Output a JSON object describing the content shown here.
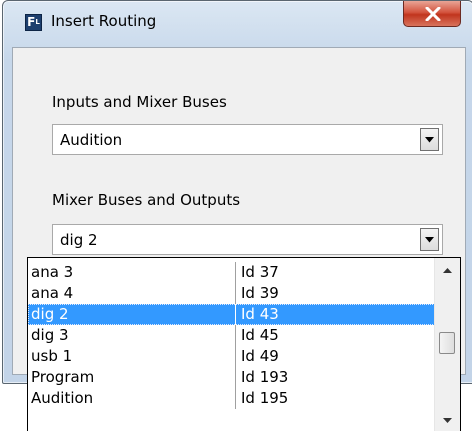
{
  "window": {
    "title": "Insert Routing",
    "icon_letter": "F",
    "icon_sub": "L",
    "icons": {
      "app": "app-logo-icon",
      "close": "close-icon"
    }
  },
  "inputs": {
    "label": "Inputs and Mixer Buses",
    "selected": "Audition"
  },
  "outputs": {
    "label": "Mixer Buses and Outputs",
    "selected": "dig 2"
  },
  "dropdown_list": {
    "rows": [
      {
        "name": "ana 3",
        "id": "Id 37"
      },
      {
        "name": "ana 4",
        "id": "Id 39"
      },
      {
        "name": "dig 2",
        "id": "Id 43"
      },
      {
        "name": "dig 3",
        "id": "Id 45"
      },
      {
        "name": "usb 1",
        "id": "Id 49"
      },
      {
        "name": "Program",
        "id": "Id 193"
      },
      {
        "name": "Audition",
        "id": "Id 195"
      }
    ],
    "selected_index": 2,
    "colors": {
      "selection": "#3399ff"
    }
  }
}
